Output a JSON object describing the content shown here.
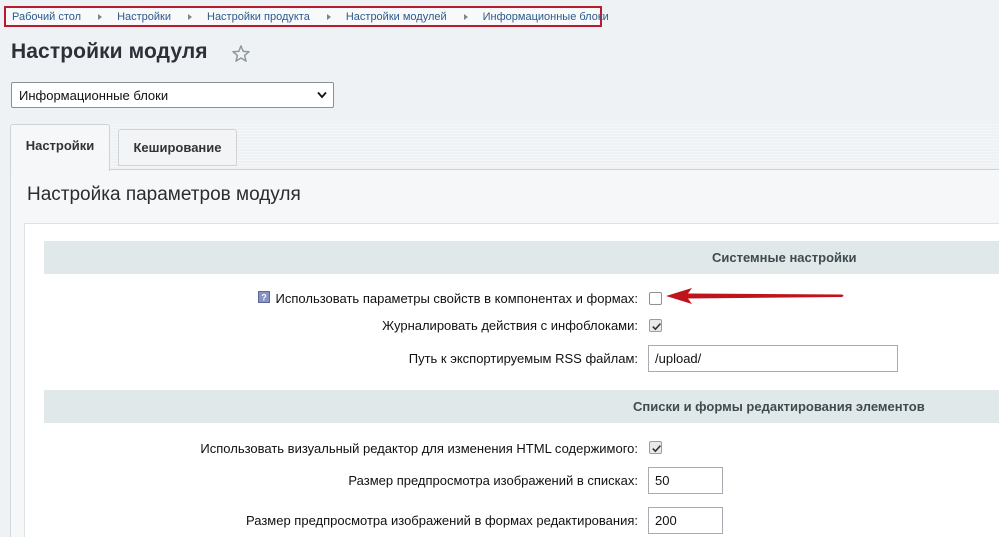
{
  "breadcrumb": [
    "Рабочий стол",
    "Настройки",
    "Настройки продукта",
    "Настройки модулей",
    "Информационные блоки"
  ],
  "page": {
    "title": "Настройки модуля"
  },
  "module_select": {
    "selected": "Информационные блоки"
  },
  "tabs": [
    {
      "label": "Настройки",
      "active": true
    },
    {
      "label": "Кеширование",
      "active": false
    }
  ],
  "section": {
    "title": "Настройка параметров модуля"
  },
  "groups": {
    "system": {
      "title": "Системные настройки",
      "rows": {
        "use_property_params": {
          "label": "Использовать параметры свойств в компонентах и формах:",
          "checked": false
        },
        "log_actions": {
          "label": "Журналировать действия с инфоблоками:",
          "checked": true
        },
        "rss_path": {
          "label": "Путь к экспортируемым RSS файлам:",
          "value": "/upload/"
        }
      }
    },
    "lists": {
      "title": "Списки и формы редактирования элементов",
      "rows": {
        "visual_editor": {
          "label": "Использовать визуальный редактор для изменения HTML содержимого:",
          "checked": true
        },
        "preview_list": {
          "label": "Размер предпросмотра изображений в списках:",
          "value": "50"
        },
        "preview_form": {
          "label": "Размер предпросмотра изображений в формах редактирования:",
          "value": "200"
        }
      }
    }
  },
  "colors": {
    "breadcrumb_border": "#b81c2e",
    "arrow": "#c0141c",
    "link": "#2d5a8c"
  }
}
